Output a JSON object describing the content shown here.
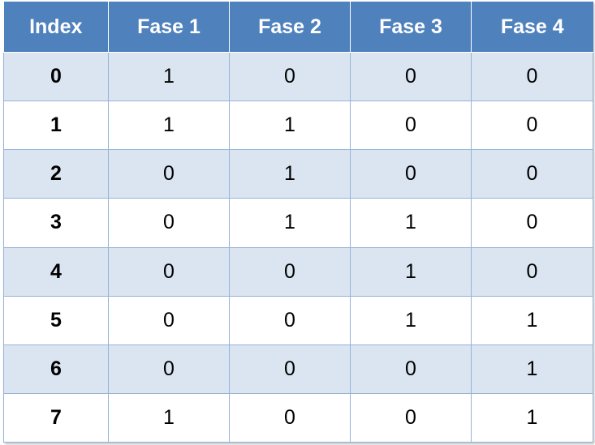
{
  "table": {
    "headers": [
      "Index",
      "Fase 1",
      "Fase 2",
      "Fase 3",
      "Fase 4"
    ],
    "rows": [
      [
        "0",
        "1",
        "0",
        "0",
        "0"
      ],
      [
        "1",
        "1",
        "1",
        "0",
        "0"
      ],
      [
        "2",
        "0",
        "1",
        "0",
        "0"
      ],
      [
        "3",
        "0",
        "1",
        "1",
        "0"
      ],
      [
        "4",
        "0",
        "0",
        "1",
        "0"
      ],
      [
        "5",
        "0",
        "0",
        "1",
        "1"
      ],
      [
        "6",
        "0",
        "0",
        "0",
        "1"
      ],
      [
        "7",
        "1",
        "0",
        "0",
        "1"
      ]
    ]
  },
  "colors": {
    "header_bg": "#4f81bd",
    "row_band": "#dbe5f1",
    "grid": "#95b3d7"
  }
}
